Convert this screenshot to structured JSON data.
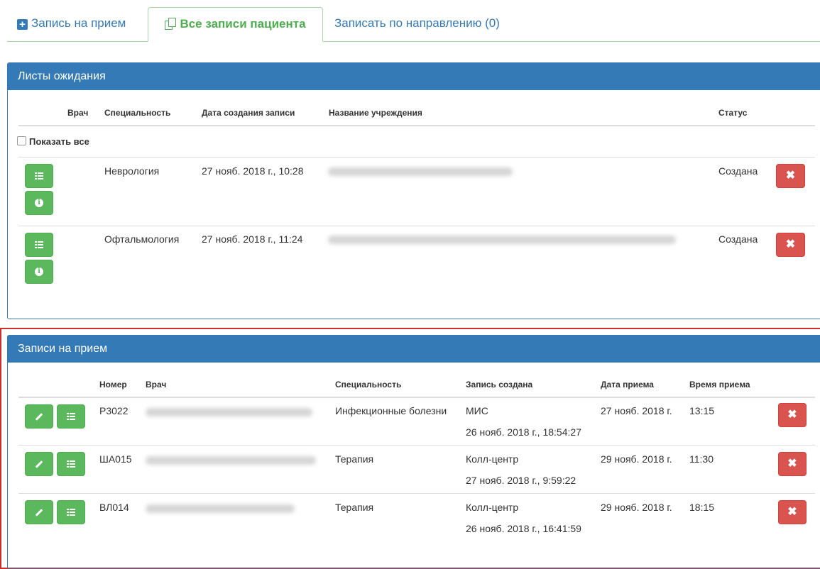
{
  "tabs": [
    {
      "label": "Запись на прием",
      "icon": "plus-square-icon"
    },
    {
      "label": "Все записи пациента",
      "icon": "copy-icon"
    },
    {
      "label": "Записать по направлению (0)"
    }
  ],
  "waitlist": {
    "title": "Листы ожидания",
    "headers": {
      "doctor": "Врач",
      "specialty": "Специальность",
      "created": "Дата создания записи",
      "institution": "Название учреждения",
      "status": "Статус"
    },
    "show_all": "Показать все",
    "rows": [
      {
        "specialty": "Неврология",
        "created": "27 нояб. 2018 г., 10:28",
        "status": "Создана"
      },
      {
        "specialty": "Офтальмология",
        "created": "27 нояб. 2018 г., 11:24",
        "status": "Создана"
      }
    ]
  },
  "appointments": {
    "title": "Записи на прием",
    "headers": {
      "number": "Номер",
      "doctor": "Врач",
      "specialty": "Специальность",
      "created": "Запись создана",
      "date": "Дата приема",
      "time": "Время приема"
    },
    "rows": [
      {
        "number": "Р3022",
        "specialty": "Инфекционные болезни",
        "source": "МИС",
        "created": "26 нояб. 2018 г., 18:54:27",
        "date": "27 нояб. 2018 г.",
        "time": "13:15"
      },
      {
        "number": "ША015",
        "specialty": "Терапия",
        "source": "Колл-центр",
        "created": "27 нояб. 2018 г., 9:59:22",
        "date": "29 нояб. 2018 г.",
        "time": "11:30"
      },
      {
        "number": "ВЛ014",
        "specialty": "Терапия",
        "source": "Колл-центр",
        "created": "26 нояб. 2018 г., 16:41:59",
        "date": "29 нояб. 2018 г.",
        "time": "18:15"
      }
    ]
  },
  "colors": {
    "primary": "#337ab7",
    "success": "#5cb85c",
    "danger": "#d9534f",
    "highlight": "#c9302c"
  }
}
